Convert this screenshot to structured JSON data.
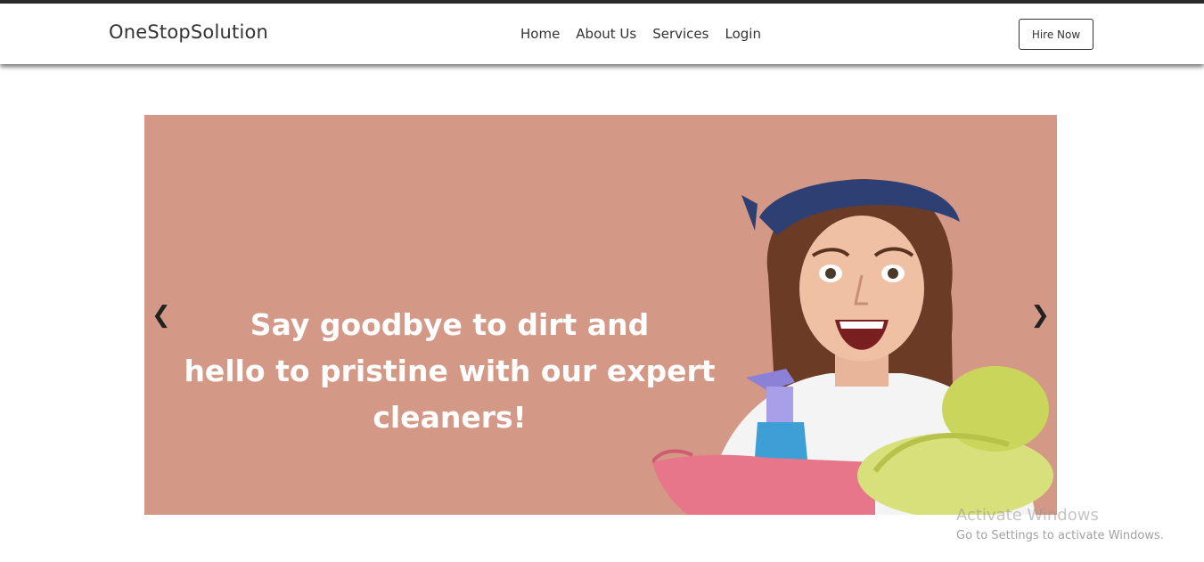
{
  "header": {
    "brand": "OneStopSolution",
    "nav": [
      {
        "label": "Home"
      },
      {
        "label": "About Us"
      },
      {
        "label": "Services"
      },
      {
        "label": "Login"
      }
    ],
    "cta_label": "Hire Now"
  },
  "hero": {
    "headline_lines": [
      "Say goodbye to dirt and",
      "hello to pristine with our expert",
      "cleaners!"
    ],
    "prev_glyph": "❮",
    "next_glyph": "❯",
    "background_color": "#d49886",
    "image_description_icon": "woman-holding-cleaning-supplies-photo"
  },
  "watermark": {
    "title": "Activate Windows",
    "subtitle": "Go to Settings to activate Windows."
  }
}
